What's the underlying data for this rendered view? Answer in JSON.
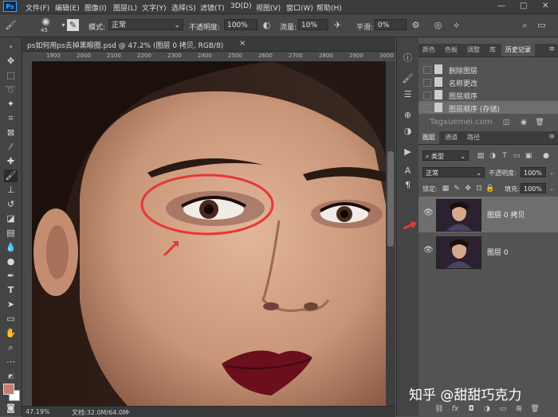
{
  "app": {
    "logo": "Ps"
  },
  "menu": [
    "文件(F)",
    "编辑(E)",
    "图像(I)",
    "图层(L)",
    "文字(Y)",
    "选择(S)",
    "滤镜(T)",
    "3D(D)",
    "视图(V)",
    "窗口(W)",
    "帮助(H)"
  ],
  "window_controls": {
    "minimize": "—",
    "maximize": "□",
    "close": "✕"
  },
  "options_bar": {
    "brush_size": "45",
    "mode_label": "模式:",
    "mode_value": "正常",
    "opacity_label": "不透明度:",
    "opacity_value": "100%",
    "flow_label": "流量:",
    "flow_value": "10%",
    "smoothing_label": "平滑:",
    "smoothing_value": "0%"
  },
  "document": {
    "tab_title": "ps如何用ps去掉黑眼圈.psd @ 47.2% (图层 0 拷贝, RGB/8)",
    "close_label": "×",
    "ruler_ticks": [
      "1900",
      "2000",
      "2100",
      "2200",
      "2300",
      "2400",
      "2500",
      "2600",
      "2700",
      "2800",
      "2900",
      "3000"
    ],
    "zoom": "47.19%",
    "doc_info": "文档:32.0M/64.0M"
  },
  "history_panel": {
    "tabs": [
      "颜色",
      "色板",
      "调整",
      "库",
      "历史记录"
    ],
    "active_tab": 4,
    "items": [
      "删除图层",
      "名称更改",
      "图层顺序",
      "图层顺序 (存储)"
    ],
    "selected_index": 3
  },
  "layers_panel": {
    "tabs": [
      "图层",
      "通道",
      "路径"
    ],
    "active_tab": 0,
    "kind_filter": "类型",
    "blend_mode": "正常",
    "opacity_label": "不透明度:",
    "opacity_value": "100%",
    "lock_label": "锁定:",
    "fill_label": "填充:",
    "fill_value": "100%",
    "layers": [
      {
        "name": "图层 0 拷贝",
        "selected": true
      },
      {
        "name": "图层 0",
        "selected": false
      }
    ]
  },
  "watermarks": {
    "site": "Tagxuemei.com",
    "zhihu": "知乎 @甜甜巧克力"
  },
  "colors": {
    "annotation_red": "#e53935",
    "accent_blue": "#31a8ff",
    "foreground_swatch": "#c97a72",
    "background_swatch": "#ffffff"
  }
}
